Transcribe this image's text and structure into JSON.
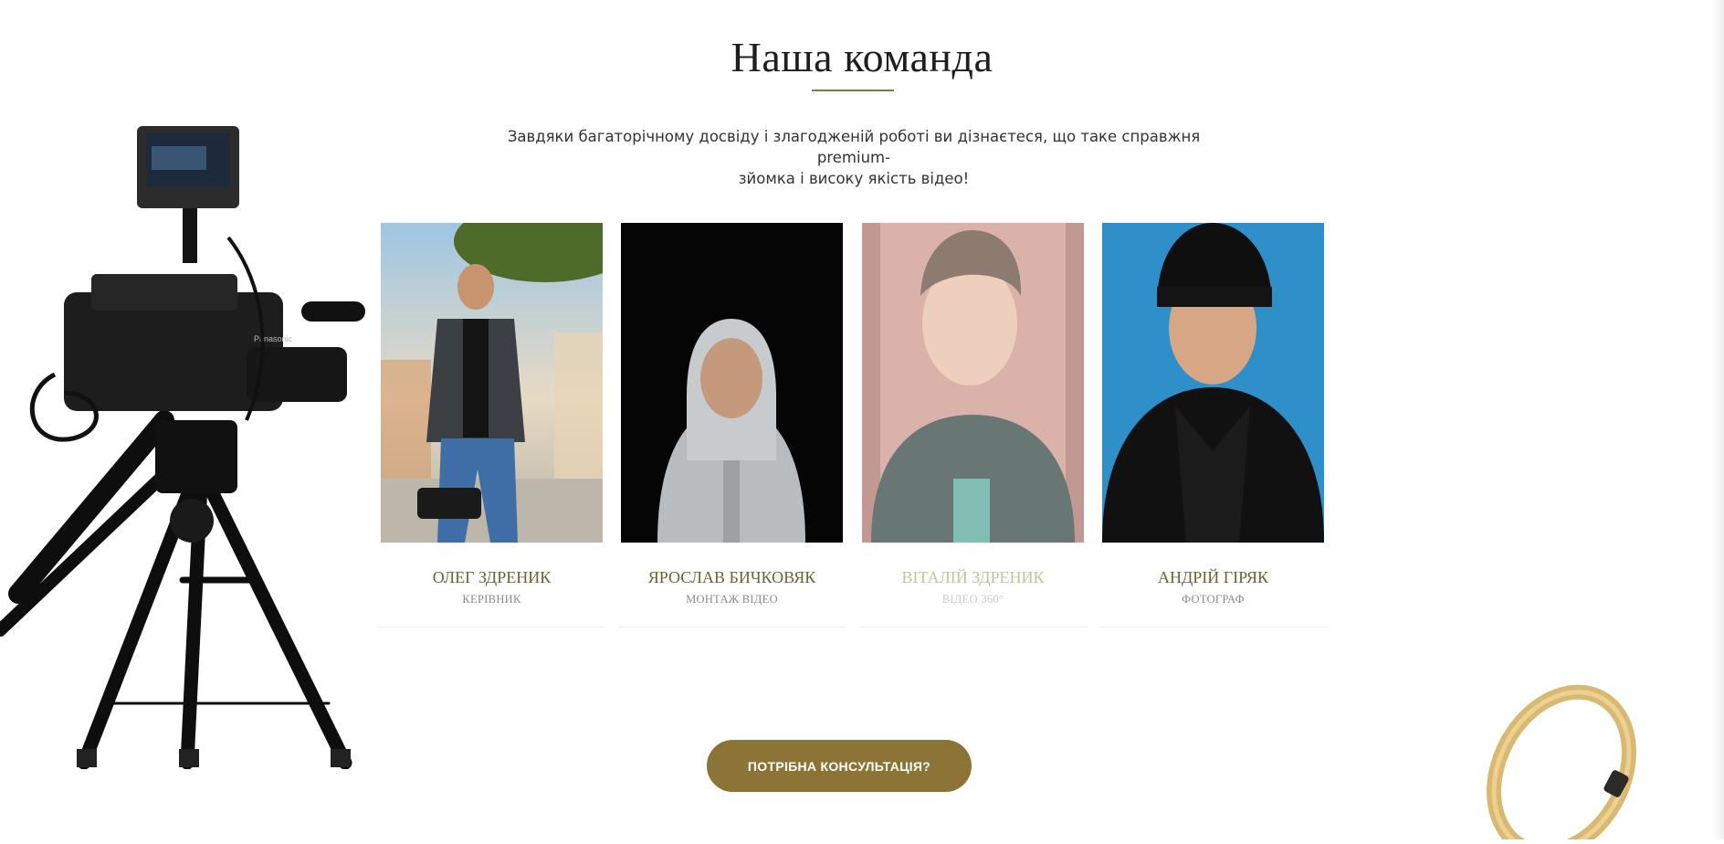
{
  "section": {
    "title": "Наша команда",
    "subtitle_line1": "Завдяки багаторічному досвіду і злагодженій роботі ви дізнаєтеся, що таке справжня premium-",
    "subtitle_line2": "зйомка і високу якість відео!"
  },
  "team": [
    {
      "name": "Олег Здреник",
      "role": "Керівник",
      "photo": "man-holding-camera-photo"
    },
    {
      "name": "Ярослав Бичковяк",
      "role": "Монтаж відео",
      "photo": "man-in-hoodie-photo"
    },
    {
      "name": "Віталій Здреник",
      "role": "Відео 360°",
      "photo": "young-man-portrait-photo"
    },
    {
      "name": "Андрій Гіряк",
      "role": "Фотограф",
      "photo": "man-in-beanie-photo"
    }
  ],
  "cta": {
    "label": "ПОТРІБНА КОНСУЛЬТАЦІЯ?"
  },
  "decor": {
    "left": "video-camera-on-tripod",
    "right": "gold-ring"
  },
  "colors": {
    "accent": "#8b7436",
    "name_gold": "#6f6130",
    "rule": "#8b7642"
  }
}
